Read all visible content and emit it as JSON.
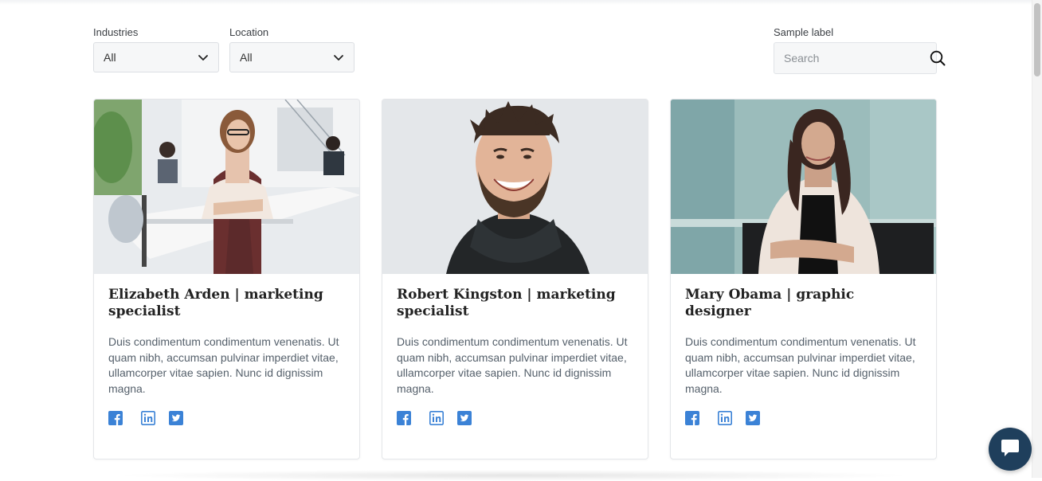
{
  "filters": {
    "industries": {
      "label": "Industries",
      "value": "All"
    },
    "location": {
      "label": "Location",
      "value": "All"
    },
    "search": {
      "label": "Sample label",
      "placeholder": "Search"
    }
  },
  "cards": [
    {
      "title": "Elizabeth Arden | marketing specialist",
      "text": "Duis condimentum condimentum venenatis. Ut quam nibh, accumsan pulvinar imperdiet vitae, ullamcorper vitae sapien. Nunc id dignissim magna."
    },
    {
      "title": "Robert Kingston | marketing specialist",
      "text": "Duis condimentum condimentum venenatis. Ut quam nibh, accumsan pulvinar imperdiet vitae, ullamcorper vitae sapien. Nunc id dignissim magna."
    },
    {
      "title": "Mary Obama | graphic designer",
      "text": "Duis condimentum condimentum venenatis. Ut quam nibh, accumsan pulvinar imperdiet vitae, ullamcorper vitae sapien. Nunc id dignissim magna."
    }
  ],
  "icons": {
    "facebook": "facebook-icon",
    "linkedin": "linkedin-icon",
    "twitter": "twitter-icon",
    "search": "search-icon",
    "chevron": "chevron-down-icon",
    "chat": "chat-icon"
  },
  "colors": {
    "social": "#3b82d6",
    "chat": "#1f3f5c"
  }
}
